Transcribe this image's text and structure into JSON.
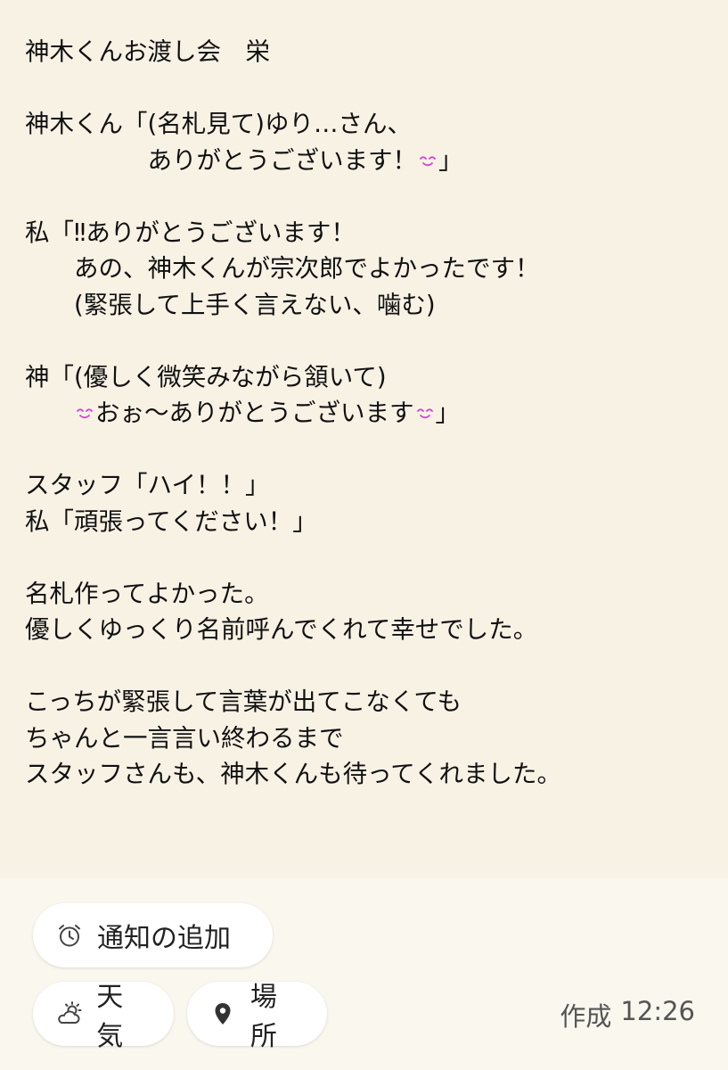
{
  "note": {
    "lines": [
      "神木くんお渡し会　栄",
      "",
      "神木くん「(名札見て)ゆり…さん、",
      "　　　　　ありがとうございます！{smile}」",
      "",
      "私「‼ありがとうございます！",
      "　　あの、神木くんが宗次郎でよかったです！",
      "　　(緊張して上手く言えない、噛む)",
      "",
      "神「(優しく微笑みながら頷いて)",
      "　　{smile}おぉ～ありがとうございます{smile}」",
      "",
      "スタッフ「ハイ！！」",
      "私「頑張ってください！」",
      "",
      "名札作ってよかった。",
      "優しくゆっくり名前呼んでくれて幸せでした。",
      "",
      "こっちが緊張して言葉が出てこなくても",
      "ちゃんと一言言い終わるまで",
      "スタッフさんも、神木くんも待ってくれました。"
    ],
    "emoji_color": "#d63fd6"
  },
  "actions": {
    "reminder_label": "通知の追加",
    "weather_label": "天気",
    "location_label": "場所"
  },
  "meta": {
    "created_label": "作成",
    "created_time": "12:26"
  },
  "icons": {
    "reminder": "alarm-clock-icon",
    "weather": "partly-cloudy-icon",
    "location": "map-pin-icon"
  }
}
